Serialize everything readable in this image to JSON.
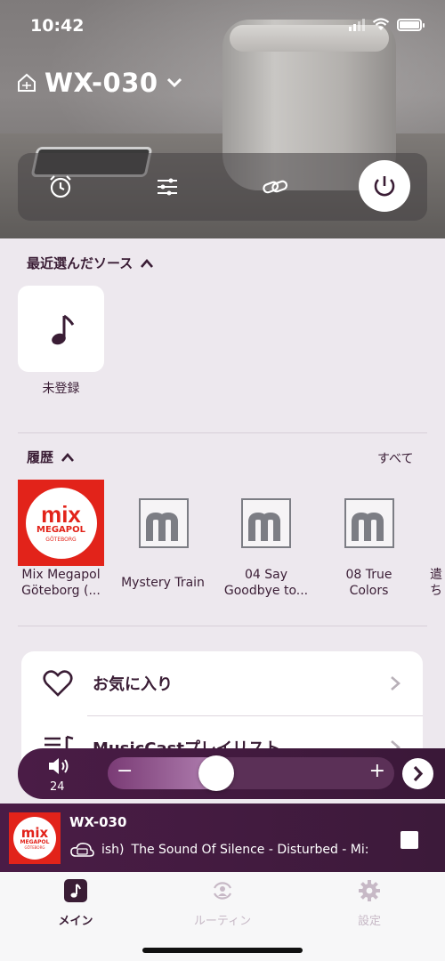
{
  "status": {
    "time": "10:42"
  },
  "device": {
    "name": "WX-030"
  },
  "controls": {
    "icons": [
      "alarm-icon",
      "equalizer-icon",
      "link-icon",
      "power-icon"
    ]
  },
  "recent": {
    "title": "最近選んだソース",
    "items": [
      {
        "label": "未登録",
        "icon": "music-note-icon"
      }
    ]
  },
  "history": {
    "title": "履歴",
    "all_label": "すべて",
    "items": [
      {
        "line1": "Mix Megapol",
        "line2": "Göteborg (..."
      },
      {
        "line1": "Mystery Train",
        "line2": ""
      },
      {
        "line1": "04 Say",
        "line2": "Goodbye to..."
      },
      {
        "line1": "08 True",
        "line2": "Colors"
      },
      {
        "line1": "遣",
        "line2": "ち"
      }
    ],
    "logo": {
      "mix": "mix",
      "megapol": "MEGAPOL",
      "city": "GÖTEBORG"
    }
  },
  "menu": {
    "items": [
      {
        "label": "お気に入り",
        "icon": "heart-icon"
      },
      {
        "label": "MusicCastプレイリスト",
        "icon": "playlist-icon"
      }
    ]
  },
  "volume": {
    "value": "24",
    "level": 0.38
  },
  "now_playing": {
    "title": "WX-030",
    "source_prefix": "ish)",
    "text": "The Sound Of Silence - Disturbed - Mi:"
  },
  "tabs": [
    {
      "label": "メイン",
      "active": true
    },
    {
      "label": "ルーティン",
      "active": false
    },
    {
      "label": "設定",
      "active": false
    }
  ],
  "colors": {
    "accent": "#3a1d35",
    "player_bg": "#4a1c46",
    "brand_red": "#e2231a"
  }
}
